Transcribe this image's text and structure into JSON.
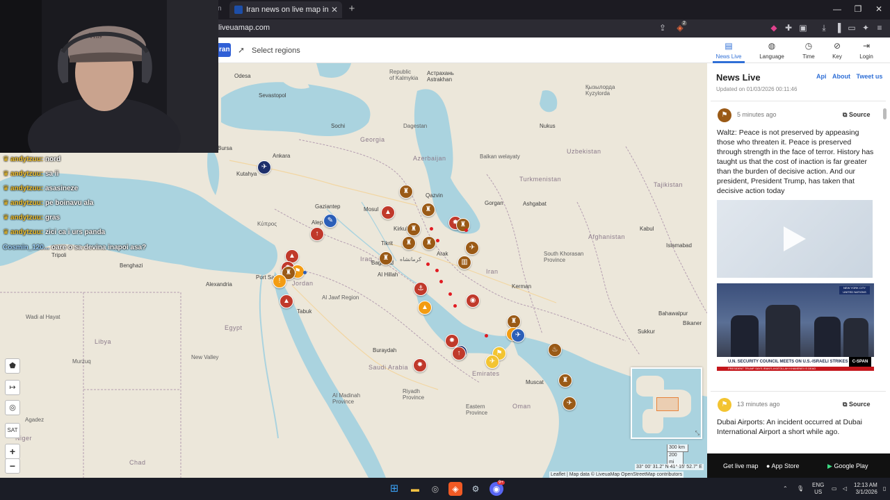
{
  "browser": {
    "prev_tab_label": "n",
    "tab_title": "Iran news on live map in English",
    "tab_close": "✕",
    "new_tab": "+",
    "url": "liveuamap.com",
    "window_controls": {
      "minimize": "—",
      "maximize": "❐",
      "close": "✕"
    },
    "shield_badge": "2"
  },
  "site": {
    "region_button": "ran",
    "select_regions": "Select regions",
    "nav": [
      {
        "label": "News Live",
        "icon": "news-icon",
        "active": true
      },
      {
        "label": "Language",
        "icon": "globe-icon",
        "active": false
      },
      {
        "label": "Time",
        "icon": "clock-icon",
        "active": false
      },
      {
        "label": "Key",
        "icon": "compass-icon",
        "active": false
      },
      {
        "label": "Login",
        "icon": "login-icon",
        "active": false
      }
    ]
  },
  "map": {
    "labels": {
      "odesa": "Odesa",
      "sevastopol": "Sevastopol",
      "sochi": "Sochi",
      "astrakhan": "Астрахань\nAstrakhan",
      "republic_kalmykia": "Republic\nof Kalmykia",
      "georgia": "Georgia",
      "azerbaijan": "Azerbaijan",
      "dagestan": "Dagestan",
      "bursa": "Bursa",
      "kutahya": "Kutahya",
      "ankara": "Ankara",
      "gaziantep": "Gaziantep",
      "aleppo": "Alep",
      "mosul": "Mosul",
      "kirkuk": "Kirkuk",
      "tikrit": "Tikrit",
      "baghdad": "Baghdad",
      "al_hillah": "Al Hillah",
      "iraq": "Iraq",
      "kypros": "Κύπρος",
      "tripoli": "Tripoli",
      "benghazi": "Benghazi",
      "alexandria": "Alexandria",
      "port_said": "Port Said",
      "jordan": "Jordan",
      "al_jawf": "Al Jawf Region",
      "tabuk": "Tabuk",
      "saudi_arabia": "Saudi Arabia",
      "buraydah": "Buraydah",
      "al_madinah": "Al Madinah\nProvince",
      "riyadh_prov": "Riyadh\nProvince",
      "eastern_prov": "Eastern\nProvince",
      "egypt": "Egypt",
      "libya": "Libya",
      "new_valley": "New Valley",
      "murzuq": "Murzuq",
      "wadi_hayat": "Wadi al Hayat",
      "chad": "Chad",
      "niger": "Niger",
      "agadez": "Agadez",
      "nukus": "Nukus",
      "uzbekistan": "Uzbekistan",
      "turkmenistan": "Turkmenistan",
      "ashgabat": "Ashgabat",
      "tajikistan": "Tajikistan",
      "islamabad": "Islamabad",
      "kabul": "Kabul",
      "afghanistan": "Afghanistan",
      "gorgan": "Gorgan",
      "qazvin": "Qazvin",
      "arak": "Arak",
      "iran": "Iran",
      "kerman": "Kerman",
      "south_khorasan": "South Khorasan\nProvince",
      "bahawalpur": "Bahawalpur",
      "sukkur": "Sukkur",
      "bikaner": "Bikaner",
      "muscat": "Muscat",
      "oman": "Oman",
      "emirates": "Emirates",
      "kazakhstan": "Қызылорда\nKyzylorda",
      "balkan": "Balkan welayaty",
      "kermanshah": "کرمانشاه"
    },
    "scale_km": "300 km",
    "scale_mi": "200 mi",
    "coords": "33° 00' 31.2\" N 41° 15' 52.7\" E",
    "attribution": "Leaflet | Map data © LiveuaMap OpenStreetMap contributors",
    "controls": {
      "zoom_in": "+",
      "zoom_out": "−",
      "sat": "SAT"
    }
  },
  "chat": [
    {
      "user": "andytzuu:",
      "message": "nord"
    },
    {
      "user": "andytzuu:",
      "message": "sa ii"
    },
    {
      "user": "andytzuu:",
      "message": "asasineze"
    },
    {
      "user": "andytzuu:",
      "message": "pe boinavu ala"
    },
    {
      "user": "andytzuu:",
      "message": "gras"
    },
    {
      "user": "andytzuu:",
      "message": "zici ca i urs panda"
    },
    {
      "user": "Cosmin_120...",
      "message": "oare o sa devina inapoi asa?"
    }
  ],
  "panel": {
    "title": "News Live",
    "links": [
      "Api",
      "About",
      "Tweet us"
    ],
    "updated": "Updated on 01/03/2026 00:11:46",
    "items": [
      {
        "time": "5 minutes ago",
        "source": "Source",
        "text": "Waltz: Peace is not preserved by appeasing those who threaten it. Peace is preserved through strength in the face of terror. History has taught us that the cost of inaction is far greater than the burden of decisive action. And our president, President Trump, has taken that decisive action today"
      },
      {
        "time": "13 minutes ago",
        "source": "Source",
        "text": "Dubai Airports: An incident occurred at Dubai International Airport a short while ago."
      }
    ],
    "tv_caption": "U.N. SECURITY COUNCIL MEETS ON U.S.-ISRAELI STRIKES AGAINST IRAN",
    "tv_ticker": "PRESIDENT TRUMP SAYS IRAN'S AYATOLLAH KHAMENEI IS DEAD",
    "tv_network": "C-SPAN",
    "tv_location": "NEW YORK CITY UNITED NATIONS"
  },
  "footer": {
    "get_live_map": "Get live map",
    "app_store": "App Store",
    "google_play": "Google Play"
  },
  "taskbar": {
    "lang": "ENG",
    "region": "US",
    "time": "12:13 AM",
    "date": "3/1/2026",
    "notif_badge": "9+"
  },
  "colors": {
    "accent": "#2f6fd6",
    "marker_brown": "#9a5a16",
    "marker_red": "#c0392b",
    "marker_orange": "#f39c12",
    "marker_blue": "#2c5fb8",
    "marker_navy": "#1d2f6b",
    "water": "#aad3df",
    "land": "#ece7da"
  }
}
